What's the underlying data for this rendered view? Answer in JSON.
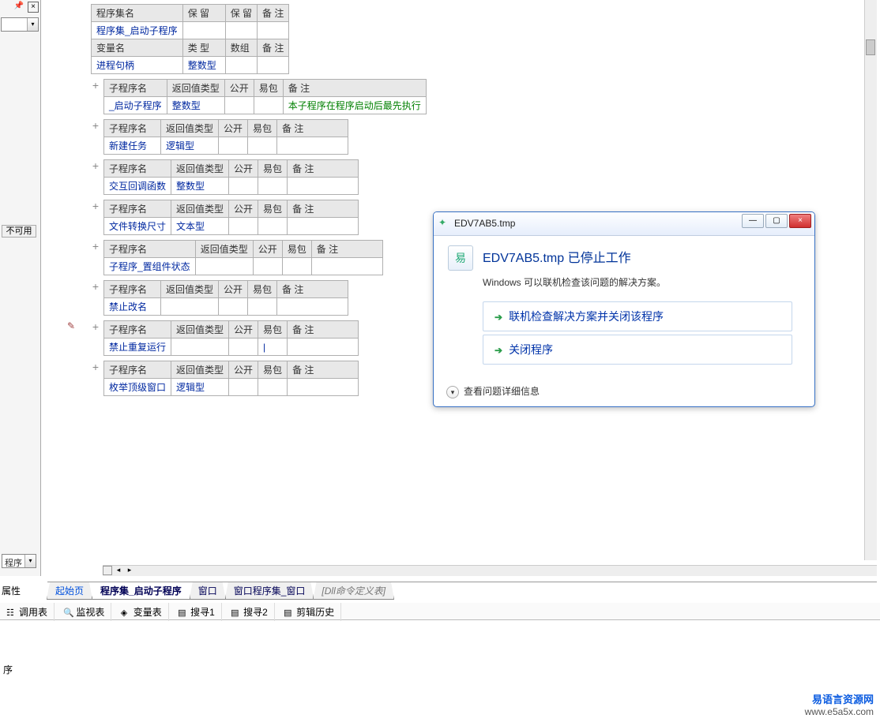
{
  "left": {
    "not_available": "不可用",
    "bottom_label": "程序",
    "prop": "属性"
  },
  "header_table": {
    "r1": {
      "c1": "程序集名",
      "c2": "保 留",
      "c3": "保 留",
      "c4": "备 注"
    },
    "r2": {
      "c1": "程序集_启动子程序"
    },
    "r3": {
      "c1": "变量名",
      "c2": "类 型",
      "c3": "数组",
      "c4": "备 注"
    },
    "r4": {
      "c1": "进程句柄",
      "c2": "整数型"
    }
  },
  "sub_tables": [
    {
      "hdr": [
        "子程序名",
        "返回值类型",
        "公开",
        "易包",
        "备 注"
      ],
      "row": [
        "_启动子程序",
        "整数型",
        "",
        "",
        "本子程序在程序启动后最先执行"
      ]
    },
    {
      "hdr": [
        "子程序名",
        "返回值类型",
        "公开",
        "易包",
        "备 注"
      ],
      "row": [
        "新建任务",
        "逻辑型",
        "",
        "",
        ""
      ]
    },
    {
      "hdr": [
        "子程序名",
        "返回值类型",
        "公开",
        "易包",
        "备 注"
      ],
      "row": [
        "交互回调函数",
        "整数型",
        "",
        "",
        ""
      ]
    },
    {
      "hdr": [
        "子程序名",
        "返回值类型",
        "公开",
        "易包",
        "备 注"
      ],
      "row": [
        "文件转换尺寸",
        "文本型",
        "",
        "",
        ""
      ]
    },
    {
      "hdr": [
        "子程序名",
        "返回值类型",
        "公开",
        "易包",
        "备 注"
      ],
      "row": [
        "子程序_置组件状态",
        "",
        "",
        "",
        ""
      ]
    },
    {
      "hdr": [
        "子程序名",
        "返回值类型",
        "公开",
        "易包",
        "备 注"
      ],
      "row": [
        "禁止改名",
        "",
        "",
        "",
        ""
      ]
    },
    {
      "hdr": [
        "子程序名",
        "返回值类型",
        "公开",
        "易包",
        "备 注"
      ],
      "row": [
        "禁止重复运行",
        "",
        "",
        "|",
        ""
      ],
      "marker": "✎"
    },
    {
      "hdr": [
        "子程序名",
        "返回值类型",
        "公开",
        "易包",
        "备 注"
      ],
      "row": [
        "枚举顶级窗口",
        "逻辑型",
        "",
        "",
        ""
      ]
    }
  ],
  "tabs": [
    "起始页",
    "程序集_启动子程序",
    "窗口",
    "窗口程序集_窗口",
    "[Dll命令定义表]"
  ],
  "toolbar": [
    "调用表",
    "监视表",
    "变量表",
    "搜寻1",
    "搜寻2",
    "剪辑历史"
  ],
  "status": "序",
  "watermark": {
    "l1": "易语言资源网",
    "l2": "www.e5a5x.com"
  },
  "dialog": {
    "title": "EDV7AB5.tmp",
    "heading": "EDV7AB5.tmp 已停止工作",
    "subtext": "Windows 可以联机检查该问题的解决方案。",
    "opt1": "联机检查解决方案并关闭该程序",
    "opt2": "关闭程序",
    "details": "查看问题详细信息"
  }
}
